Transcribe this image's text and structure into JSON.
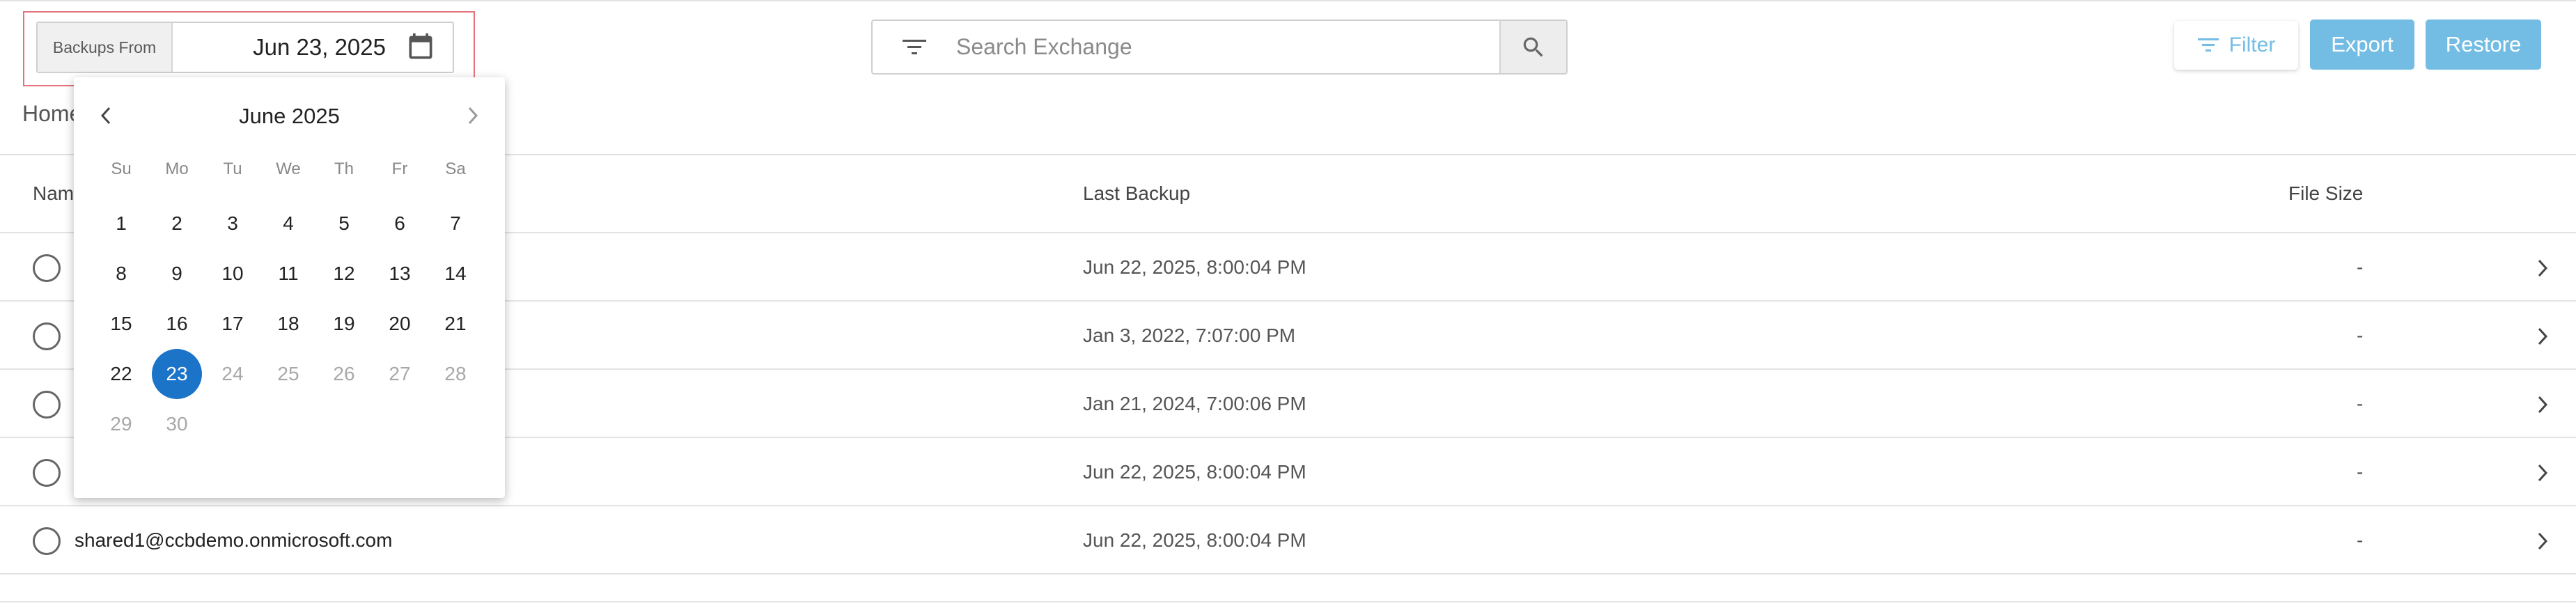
{
  "date_filter": {
    "label": "Backups From",
    "value": "Jun 23, 2025",
    "icon": "calendar-icon"
  },
  "search": {
    "placeholder": "Search Exchange",
    "filter_icon": "filter-lines-icon",
    "button_icon": "search-icon"
  },
  "toolbar": {
    "filter_label": "Filter",
    "export_label": "Export",
    "restore_label": "Restore",
    "accent_color": "#73bde5"
  },
  "breadcrumb": {
    "home": "Home"
  },
  "table": {
    "headers": {
      "name": "Name",
      "last_backup": "Last Backup",
      "file_size": "File Size"
    },
    "rows": [
      {
        "name": "",
        "last_backup": "Jun 22, 2025, 8:00:04 PM",
        "file_size": "-"
      },
      {
        "name": "",
        "last_backup": "Jan 3, 2022, 7:07:00 PM",
        "file_size": "-"
      },
      {
        "name": "",
        "last_backup": "Jan 21, 2024, 7:00:06 PM",
        "file_size": "-"
      },
      {
        "name": "",
        "last_backup": "Jun 22, 2025, 8:00:04 PM",
        "file_size": "-"
      },
      {
        "name": "shared1@ccbdemo.onmicrosoft.com",
        "last_backup": "Jun 22, 2025, 8:00:04 PM",
        "file_size": "-"
      }
    ]
  },
  "calendar": {
    "month_title": "June 2025",
    "weekdays": [
      "Su",
      "Mo",
      "Tu",
      "We",
      "Th",
      "Fr",
      "Sa"
    ],
    "weeks": [
      [
        "1",
        "2",
        "3",
        "4",
        "5",
        "6",
        "7"
      ],
      [
        "8",
        "9",
        "10",
        "11",
        "12",
        "13",
        "14"
      ],
      [
        "15",
        "16",
        "17",
        "18",
        "19",
        "20",
        "21"
      ],
      [
        "22",
        "23",
        "24",
        "25",
        "26",
        "27",
        "28"
      ],
      [
        "29",
        "30"
      ]
    ],
    "selected_day": "23",
    "selected_color": "#1b74c8",
    "last_enabled_day": "23"
  }
}
